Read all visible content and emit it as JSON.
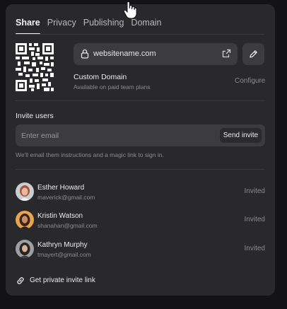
{
  "tabs": [
    {
      "label": "Share",
      "active": true
    },
    {
      "label": "Privacy",
      "active": false
    },
    {
      "label": "Publishing",
      "active": false
    },
    {
      "label": "Domain",
      "active": false
    }
  ],
  "site": {
    "url": "websitename.com",
    "lock_icon": "lock-icon",
    "open_icon": "external-link-icon",
    "edit_icon": "pencil-icon"
  },
  "custom_domain": {
    "title": "Custom Domain",
    "subtitle": "Available on paid team plans",
    "action": "Configure"
  },
  "invite": {
    "label": "Invite users",
    "placeholder": "Enter email",
    "button": "Send invite",
    "hint": "We'll email them instructions and a magic link to sign in."
  },
  "users": [
    {
      "name": "Esther Howard",
      "email": "maverick@gmail.com",
      "status": "Invited"
    },
    {
      "name": "Kristin Watson",
      "email": "shanahan@gmail.com",
      "status": "Invited"
    },
    {
      "name": "Kathryn Murphy",
      "email": "tmayert@gmail.com",
      "status": "Invited"
    }
  ],
  "private_link": {
    "label": "Get private invite link",
    "icon": "link-icon"
  },
  "colors": {
    "background": "#131315",
    "panel": "#29292c",
    "field": "#3b3b40",
    "text": "#ededf0",
    "muted": "#8c8c92"
  }
}
